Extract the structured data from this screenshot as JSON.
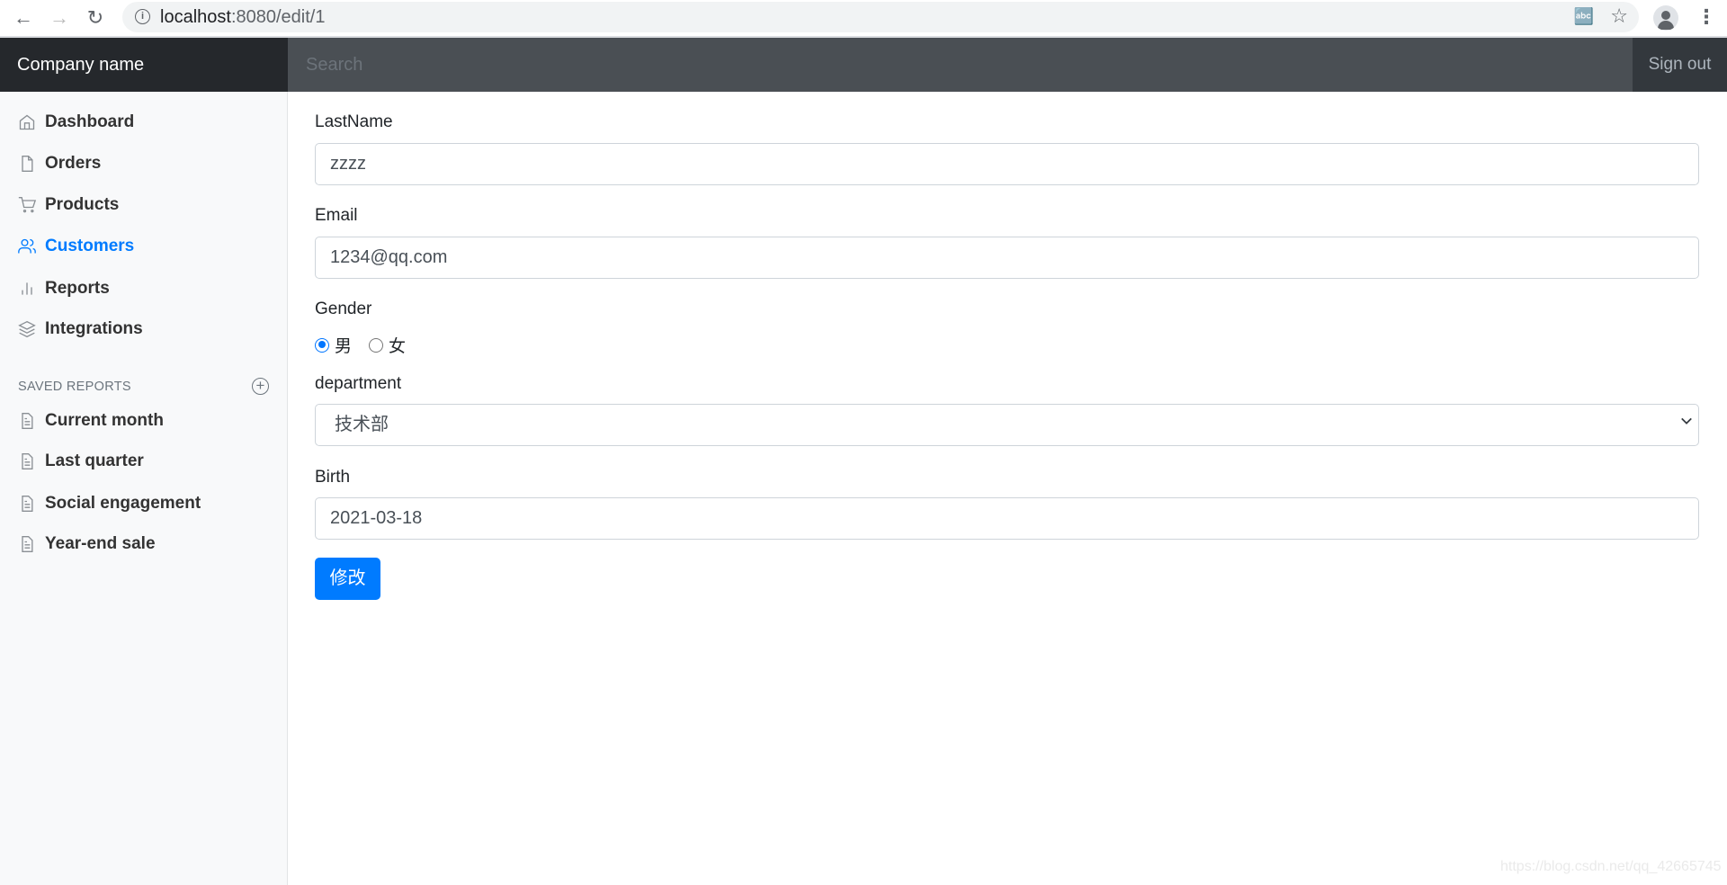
{
  "browser": {
    "url_host": "localhost",
    "url_path": ":8080/edit/1"
  },
  "navbar": {
    "brand": "Company name",
    "search_placeholder": "Search",
    "signout": "Sign out"
  },
  "sidebar": {
    "items": [
      {
        "label": "Dashboard",
        "icon": "home-icon"
      },
      {
        "label": "Orders",
        "icon": "file-icon"
      },
      {
        "label": "Products",
        "icon": "shopping-cart-icon"
      },
      {
        "label": "Customers",
        "icon": "users-icon",
        "active": true
      },
      {
        "label": "Reports",
        "icon": "bar-chart-icon"
      },
      {
        "label": "Integrations",
        "icon": "layers-icon"
      }
    ],
    "saved_heading": "SAVED REPORTS",
    "saved": [
      {
        "label": "Current month"
      },
      {
        "label": "Last quarter"
      },
      {
        "label": "Social engagement"
      },
      {
        "label": "Year-end sale"
      }
    ]
  },
  "form": {
    "lastname_label": "LastName",
    "lastname_value": "zzzz",
    "email_label": "Email",
    "email_value": "1234@qq.com",
    "gender_label": "Gender",
    "gender_options": [
      "男",
      "女"
    ],
    "gender_selected": "男",
    "department_label": "department",
    "department_value": "技术部",
    "birth_label": "Birth",
    "birth_value": "2021-03-18",
    "submit": "修改"
  },
  "watermark": "https://blog.csdn.net/qq_42665745",
  "colors": {
    "accent": "#007bff",
    "navbar": "#4a4f54",
    "brand_bg": "#25282c"
  }
}
